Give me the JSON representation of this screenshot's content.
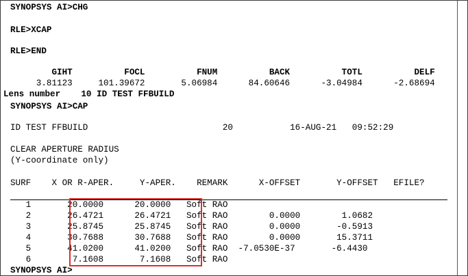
{
  "terminal": {
    "prompt1": "SYNOPSYS AI>CHG",
    "cmd_xcap": "RLE>XCAP",
    "cmd_end": "RLE>END",
    "params_header": "        GIHT          FOCL          FNUM          BACK          TOTL          DELF",
    "params_values": "     3.81123     101.39672       5.06984      84.60646      -3.04984      -2.68694",
    "lens_number": "Lens number    10 ID TEST FFBUILD",
    "prompt2": "SYNOPSYS AI>CAP",
    "id_line": "ID TEST FFBUILD                          20           16-AUG-21   09:52:29",
    "title": "CLEAR APERTURE RADIUS",
    "subtitle": "(Y-coordinate only)",
    "table_header": "SURF    X OR R-APER.     Y-APER.    REMARK      X-OFFSET       Y-OFFSET   EFILE?",
    "rows": [
      "   1       20.0000      20.0000   Soft RAO",
      "   2       26.4721      26.4721   Soft RAO        0.0000        1.0682",
      "   3       25.8745      25.8745   Soft RAO        0.0000       -0.5913",
      "   4       30.7688      30.7688   Soft RAO        0.0000       15.3711",
      "   5       41.0200      41.0200   Soft RAO  -7.0530E-37       -6.4430",
      "   6        7.1608       7.1608   Soft RAO"
    ],
    "final_prompt": "SYNOPSYS AI>"
  },
  "colors": {
    "highlight": "#d9302c"
  }
}
